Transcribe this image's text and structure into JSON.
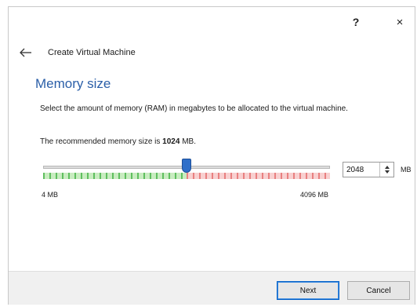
{
  "window": {
    "help_label": "?",
    "close_label": "×"
  },
  "wizard": {
    "title": "Create Virtual Machine"
  },
  "page": {
    "heading": "Memory size",
    "description": "Select the amount of memory (RAM) in megabytes to be allocated to the virtual machine.",
    "recommend_prefix": "The recommended memory size is ",
    "recommend_value": "1024",
    "recommend_suffix": " MB."
  },
  "memory": {
    "min_label": "4 MB",
    "max_label": "4096 MB",
    "min_value": 4,
    "max_value": 4096,
    "recommended_value": 1024,
    "current_value": 2048,
    "input_value": "2048",
    "unit": "MB",
    "safe_color": "#5fbf5f",
    "warn_color": "#e88080"
  },
  "footer": {
    "next_label": "Next",
    "cancel_label": "Cancel"
  },
  "icons": {
    "back": "back-arrow-icon",
    "spin": "spin-arrows-icon"
  }
}
